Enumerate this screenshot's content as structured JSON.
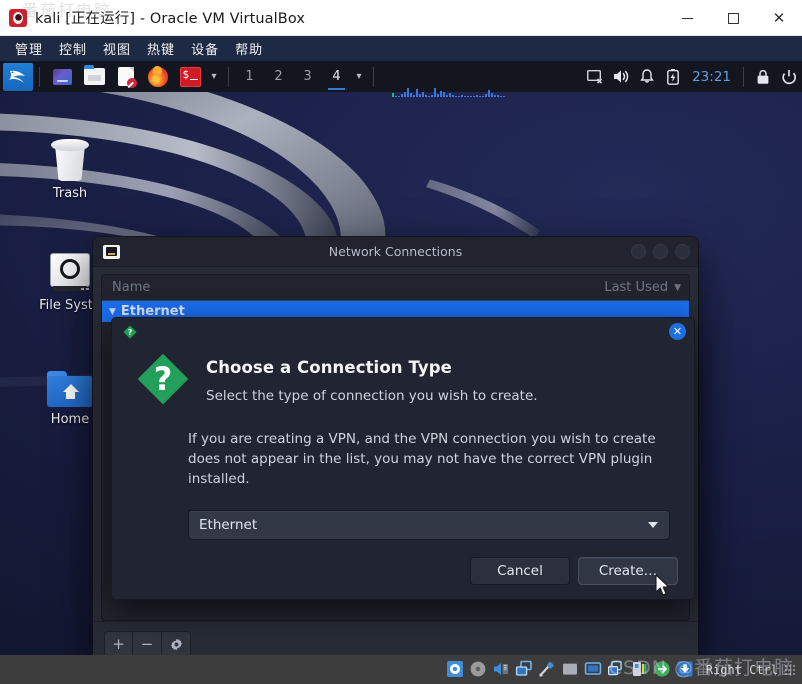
{
  "host_window": {
    "title": "kali [正在运行] - Oracle VM VirtualBox",
    "app_icon": "virtualbox-icon",
    "watermark_top": "番茄打电脑",
    "controls": {
      "minimize": "minimize-button",
      "maximize": "maximize-button",
      "close": "✕"
    },
    "menubar": [
      "管理",
      "控制",
      "视图",
      "热键",
      "设备",
      "帮助"
    ]
  },
  "kali_panel": {
    "menu_icon": "kali-dragon-icon",
    "launchers": [
      {
        "name": "file-manager-launcher",
        "icon": "files-icon"
      },
      {
        "name": "folder-launcher",
        "icon": "folder-icon"
      },
      {
        "name": "text-editor-launcher",
        "icon": "document-icon"
      },
      {
        "name": "firefox-launcher",
        "icon": "firefox-icon"
      },
      {
        "name": "terminal-launcher",
        "icon": "terminal-icon"
      }
    ],
    "launcher_chevron": "▾",
    "workspaces": [
      "1",
      "2",
      "3",
      "4"
    ],
    "active_workspace": "4",
    "workspace_chevron": "▾",
    "tray": [
      {
        "name": "display-off-icon"
      },
      {
        "name": "volume-icon"
      },
      {
        "name": "notification-bell-icon"
      },
      {
        "name": "battery-icon"
      }
    ],
    "clock": "23:21",
    "session": [
      {
        "name": "lock-screen-icon"
      },
      {
        "name": "logout-icon"
      }
    ]
  },
  "desktop": {
    "icons": [
      {
        "name": "trash-icon",
        "label": "Trash"
      },
      {
        "name": "file-system-icon",
        "label": "File Syste"
      },
      {
        "name": "home-icon",
        "label": "Home"
      }
    ]
  },
  "network_connections": {
    "title": "Network Connections",
    "title_icon": "ethernet-port-icon",
    "window_buttons": [
      "minimize",
      "maximize",
      "close"
    ],
    "columns": {
      "name": "Name",
      "last_used": "Last Used",
      "sort_caret": "▼"
    },
    "rows": [
      {
        "expander": "▼",
        "name": "Ethernet",
        "last_used": "",
        "selected": true
      }
    ],
    "toolbar": [
      {
        "name": "add-connection-button",
        "glyph": "+"
      },
      {
        "name": "remove-connection-button",
        "glyph": "−"
      },
      {
        "name": "edit-connection-button",
        "glyph": "gear-icon"
      }
    ]
  },
  "choose_connection_dialog": {
    "mini_icon": "question-diamond-icon",
    "close_label": "✕",
    "big_icon": "question-diamond-icon",
    "heading": "Choose a Connection Type",
    "subtitle": "Select the type of connection you wish to create.",
    "paragraph": "If you are creating a VPN, and the VPN connection you wish to create does not appear in the list, you may not have the correct VPN plugin installed.",
    "select": {
      "name": "connection-type-select",
      "value": "Ethernet",
      "caret": "▼"
    },
    "buttons": [
      {
        "name": "cancel-button",
        "label": "Cancel",
        "focused": false
      },
      {
        "name": "create-button",
        "label": "Create…",
        "focused": true
      }
    ]
  },
  "status_bar": {
    "icons": [
      {
        "name": "hard-disk-icon"
      },
      {
        "name": "optical-disk-icon"
      },
      {
        "name": "audio-icon"
      },
      {
        "name": "network-icon"
      },
      {
        "name": "usb-icon"
      },
      {
        "name": "shared-folder-icon"
      },
      {
        "name": "display-icon"
      },
      {
        "name": "recording-icon"
      },
      {
        "name": "vm-state-icon"
      },
      {
        "name": "mouse-integration-icon"
      },
      {
        "name": "guest-additions-icon"
      }
    ],
    "host_key": "Right Ctrl",
    "resize_grip": "resize-grip"
  },
  "watermark": "CSDN @番茄打电脑",
  "colors": {
    "accent_blue": "#1a6ef0",
    "green_icon": "#2aab5e",
    "panel_bg": "#14161f",
    "dialog_bg": "#212531",
    "wallpaper_navy": "#1b2048",
    "clock_blue": "#5b9fe3"
  }
}
